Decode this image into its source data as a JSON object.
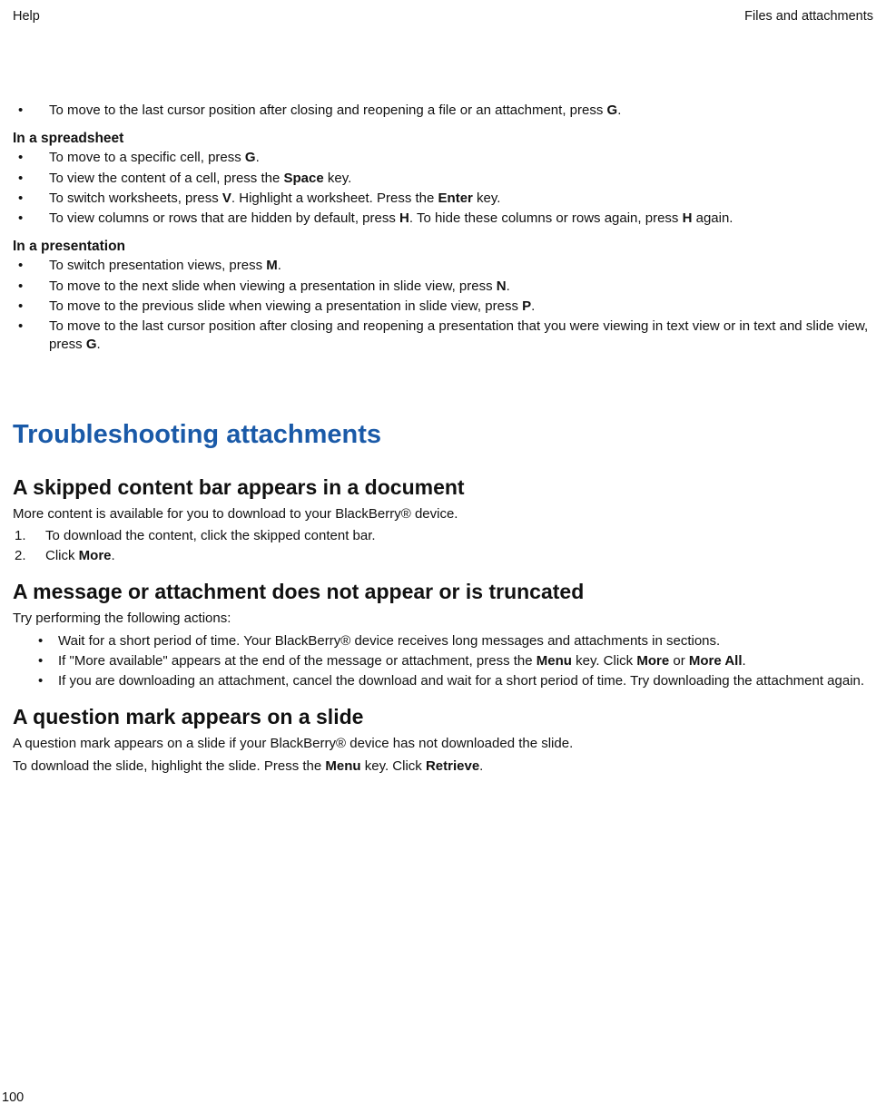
{
  "header": {
    "left": "Help",
    "right": "Files and attachments"
  },
  "top_bullet": {
    "pre": "To move to the last cursor position after closing and reopening a file or an attachment, press ",
    "k": "G",
    "post": "."
  },
  "spreadsheet": {
    "title": "In a spreadsheet",
    "b1": {
      "pre": "To move to a specific cell, press ",
      "k": "G",
      "post": "."
    },
    "b2": {
      "pre": "To view the content of a cell, press the ",
      "k": "Space",
      "post": " key."
    },
    "b3": {
      "pre": "To switch worksheets, press ",
      "k1": "V",
      "mid": ". Highlight a worksheet. Press the ",
      "k2": "Enter",
      "post": " key."
    },
    "b4": {
      "pre": "To view columns or rows that are hidden by default, press ",
      "k1": "H",
      "mid": ". To hide these columns or rows again, press ",
      "k2": "H",
      "post": " again."
    }
  },
  "presentation": {
    "title": "In a presentation",
    "b1": {
      "pre": "To switch presentation views, press ",
      "k": "M",
      "post": "."
    },
    "b2": {
      "pre": "To move to the next slide when viewing a presentation in slide view, press ",
      "k": "N",
      "post": "."
    },
    "b3": {
      "pre": "To move to the previous slide when viewing a presentation in slide view, press ",
      "k": "P",
      "post": "."
    },
    "b4": {
      "pre": "To move to the last cursor position after closing and reopening a presentation that you were viewing in text view or in text and slide view, press ",
      "k": "G",
      "post": "."
    }
  },
  "troubleshooting": {
    "h1": "Troubleshooting attachments",
    "s1": {
      "h2": "A skipped content bar appears in a document",
      "p": "More content is available for you to download to your BlackBerry® device.",
      "o1": "To download the content, click the skipped content bar.",
      "o2": {
        "pre": "Click ",
        "k": "More",
        "post": "."
      }
    },
    "s2": {
      "h2": "A message or attachment does not appear or is truncated",
      "p": "Try performing the following actions:",
      "b1": "Wait for a short period of time. Your BlackBerry® device receives long messages and attachments in sections.",
      "b2": {
        "pre": "If \"More available\" appears at the end of the message or attachment, press the ",
        "k1": "Menu",
        "mid": " key. Click ",
        "k2": "More",
        "or": " or ",
        "k3": "More All",
        "post": "."
      },
      "b3": "If you are downloading an attachment, cancel the download and wait for a short period of time. Try downloading the attachment again."
    },
    "s3": {
      "h2": "A question mark appears on a slide",
      "p1": "A question mark appears on a slide if your BlackBerry® device has not downloaded the slide.",
      "p2": {
        "pre": "To download the slide, highlight the slide. Press the ",
        "k1": "Menu",
        "mid": " key. Click ",
        "k2": "Retrieve",
        "post": "."
      }
    }
  },
  "page_number": "100"
}
